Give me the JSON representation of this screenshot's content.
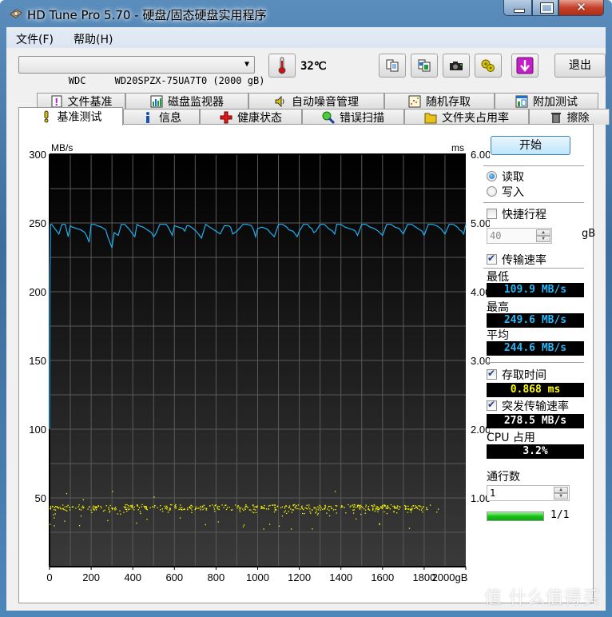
{
  "window": {
    "title": "HD Tune Pro 5.70 - 硬盘/固态硬盘实用程序",
    "controls": {
      "minimize": "minimize",
      "maximize": "maximize",
      "close": "✕"
    }
  },
  "menu": [
    {
      "label": "文件(F)"
    },
    {
      "label": "帮助(H)"
    }
  ],
  "toolbar": {
    "drive": "WDC     WD20SPZX-75UA7T0 (2000 gB)",
    "temperature": "32℃",
    "icons": [
      "copy-text-icon",
      "copy-screenshot-icon",
      "camera-icon",
      "options-icon",
      "save-down-icon"
    ],
    "exit_label": "退出"
  },
  "tabs_top": [
    {
      "label": "文件基准",
      "icon": "file-benchmark-icon"
    },
    {
      "label": "磁盘监视器",
      "icon": "disk-monitor-icon"
    },
    {
      "label": "自动噪音管理",
      "icon": "speaker-icon"
    },
    {
      "label": "随机存取",
      "icon": "random-access-icon"
    },
    {
      "label": "附加测试",
      "icon": "extra-tests-icon"
    }
  ],
  "tabs_bottom": [
    {
      "label": "基准测试",
      "icon": "benchmark-icon",
      "active": true
    },
    {
      "label": "信息",
      "icon": "info-icon"
    },
    {
      "label": "健康状态",
      "icon": "health-cross-icon"
    },
    {
      "label": "错误扫描",
      "icon": "magnifier-icon"
    },
    {
      "label": "文件夹占用率",
      "icon": "folder-icon"
    },
    {
      "label": "擦除",
      "icon": "trash-icon"
    }
  ],
  "side": {
    "start_label": "开始",
    "mode_read": "读取",
    "mode_write": "写入",
    "mode_selected": "read",
    "short_stroke_label": "快捷行程",
    "short_stroke_checked": false,
    "short_stroke_value": "40",
    "short_stroke_unit": "gB",
    "transfer_rate_label": "传输速率",
    "transfer_rate_checked": true,
    "min_label": "最低",
    "min_value": "109.9 MB/s",
    "max_label": "最高",
    "max_value": "249.6 MB/s",
    "avg_label": "平均",
    "avg_value": "244.6 MB/s",
    "access_time_label": "存取时间",
    "access_time_checked": true,
    "access_time_value": "0.868 ms",
    "burst_label": "突发传输速率",
    "burst_checked": true,
    "burst_value": "278.5 MB/s",
    "cpu_label": "CPU 占用",
    "cpu_value": "3.2%",
    "passes_label": "通行数",
    "passes_value": "1",
    "progress_fraction": 1.0,
    "progress_text": "1/1"
  },
  "colors": {
    "transfer_line": "#1fb0f0",
    "access_points": "#ffff00",
    "readout_blue": "#29b6f6",
    "readout_yellow": "#ffff00",
    "readout_white": "#ffffff"
  },
  "watermark": "值 什么值得买",
  "chart_data": {
    "type": "line",
    "title": "",
    "xlabel": "gB",
    "ylabel_left": "MB/s",
    "ylabel_right": "ms",
    "xlim": [
      0,
      2000
    ],
    "ylim_left": [
      0,
      300
    ],
    "ylim_right": [
      0,
      6
    ],
    "x_ticks": [
      "0",
      "200",
      "400",
      "600",
      "800",
      "1000",
      "1200",
      "1400",
      "1600",
      "1800",
      "2000gB"
    ],
    "y_ticks_left": [
      "300",
      "250",
      "200",
      "150",
      "100",
      "50"
    ],
    "y_ticks_right": [
      "6.00",
      "5.00",
      "4.00",
      "3.00",
      "2.00",
      "1.00"
    ],
    "grid": true,
    "series": [
      {
        "name": "Transfer rate (MB/s)",
        "axis": "left",
        "x": [
          0,
          2,
          5,
          10,
          30,
          45,
          60,
          75,
          90,
          100,
          110,
          130,
          150,
          170,
          180,
          190,
          200,
          215,
          230,
          250,
          270,
          280,
          300,
          310,
          320,
          330,
          345,
          360,
          380,
          400,
          410,
          420,
          430,
          450,
          470,
          490,
          500,
          510,
          530,
          550,
          560,
          570,
          580,
          590,
          600,
          620,
          640,
          650,
          660,
          670,
          690,
          710,
          730,
          750,
          760,
          770,
          780,
          800,
          820,
          840,
          860,
          870,
          880,
          890,
          900,
          930,
          950,
          970,
          980,
          990,
          1000,
          1020,
          1040,
          1050,
          1060,
          1080,
          1100,
          1120,
          1140,
          1150,
          1170,
          1190,
          1200,
          1220,
          1240,
          1250,
          1260,
          1270,
          1280,
          1300,
          1320,
          1340,
          1360,
          1370,
          1380,
          1400,
          1420,
          1440,
          1460,
          1470,
          1480,
          1500,
          1520,
          1540,
          1560,
          1570,
          1580,
          1600,
          1620,
          1640,
          1660,
          1680,
          1690,
          1700,
          1720,
          1740,
          1760,
          1780,
          1790,
          1800,
          1820,
          1840,
          1860,
          1880,
          1890,
          1900,
          1920,
          1940,
          1960,
          1970,
          1980,
          1990,
          2000
        ],
        "values": [
          100,
          215,
          249,
          249,
          245,
          242,
          249,
          249,
          240,
          248,
          247,
          246,
          245,
          243,
          240,
          236,
          249,
          249,
          248,
          247,
          245,
          240,
          232,
          243,
          242,
          241,
          249,
          249,
          246,
          242,
          240,
          249,
          248,
          247,
          245,
          243,
          240,
          242,
          249,
          249,
          249,
          247,
          244,
          241,
          248,
          247,
          246,
          244,
          248,
          248,
          246,
          243,
          239,
          249,
          248,
          247,
          246,
          244,
          242,
          248,
          248,
          247,
          242,
          243,
          244,
          249,
          249,
          248,
          245,
          240,
          246,
          247,
          246,
          245,
          243,
          240,
          249,
          249,
          247,
          245,
          244,
          240,
          244,
          249,
          249,
          247,
          246,
          243,
          244,
          249,
          249,
          246,
          244,
          242,
          249,
          249,
          247,
          246,
          245,
          244,
          241,
          249,
          249,
          247,
          246,
          245,
          244,
          241,
          249,
          249,
          247,
          246,
          244,
          242,
          249,
          249,
          247,
          245,
          244,
          241,
          249,
          249,
          248,
          246,
          244,
          242,
          249,
          249,
          247,
          245,
          244,
          242,
          249
        ],
        "note": "approximate trace; sustained ~240-249 MB/s with periodic dips"
      },
      {
        "name": "Access time (ms)",
        "axis": "right",
        "type": "scatter",
        "typical_range_ms": [
          0.55,
          0.95
        ],
        "cluster_center_ms": 0.87,
        "x_extent": [
          0,
          1900
        ],
        "note": "scatter of yellow points; dense band ~0.85-0.9 ms until ~1820 gB"
      }
    ]
  }
}
